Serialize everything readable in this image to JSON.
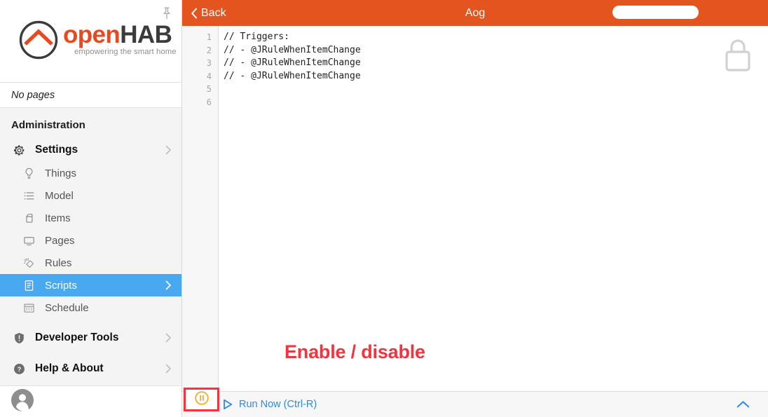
{
  "sidebar": {
    "pin_icon": "pushpin-icon",
    "logo": {
      "word_open": "open",
      "word_hab": "HAB",
      "tagline": "empowering the smart home",
      "orange": "#e8491f",
      "dark": "#3b3b3b"
    },
    "pages_status": "No pages",
    "section_title": "Administration",
    "items": [
      {
        "label": "Settings",
        "icon": "gear-icon",
        "level": "top",
        "chevron": true,
        "active": false
      },
      {
        "label": "Things",
        "icon": "bulb-icon",
        "level": "sub",
        "chevron": false,
        "active": false
      },
      {
        "label": "Model",
        "icon": "list-icon",
        "level": "sub",
        "chevron": false,
        "active": false
      },
      {
        "label": "Items",
        "icon": "shapes-icon",
        "level": "sub",
        "chevron": false,
        "active": false
      },
      {
        "label": "Pages",
        "icon": "monitor-icon",
        "level": "sub",
        "chevron": false,
        "active": false
      },
      {
        "label": "Rules",
        "icon": "magic-wand-icon",
        "level": "sub",
        "chevron": false,
        "active": false
      },
      {
        "label": "Scripts",
        "icon": "script-icon",
        "level": "sub",
        "chevron": true,
        "active": true
      },
      {
        "label": "Schedule",
        "icon": "calendar-icon",
        "level": "sub",
        "chevron": false,
        "active": false
      },
      {
        "label": "Developer Tools",
        "icon": "shield-icon",
        "level": "top-plain",
        "chevron": true,
        "active": false
      },
      {
        "label": "Help & About",
        "icon": "question-icon",
        "level": "top-plain",
        "chevron": true,
        "active": false
      }
    ],
    "active_color": "#48a8f0",
    "avatar_icon": "avatar-icon"
  },
  "topbar": {
    "back_label": "Back",
    "back_icon": "chevron-left-icon",
    "title_prefix": "A",
    "title_suffix": "og",
    "background": "#e4541e",
    "title_redacted": true
  },
  "editor": {
    "line_numbers": [
      "1",
      "2",
      "3",
      "4",
      "5",
      "6"
    ],
    "code": "// Triggers:\n// - @JRuleWhenItemChange\n// - @JRuleWhenItemChange\n// - @JRuleWhenItemChange\n\n",
    "lock_icon": "lock-icon",
    "annotation": "Enable / disable",
    "annotation_color": "#f5333f"
  },
  "bottombar": {
    "pause_icon": "pause-circle-icon",
    "pause_color": "#f5a623",
    "highlight_color": "#f5333f",
    "run_icon": "play-outline-icon",
    "run_label": "Run Now (Ctrl-R)",
    "run_color": "#2f89e5",
    "collapse_icon": "chevron-up-icon"
  }
}
